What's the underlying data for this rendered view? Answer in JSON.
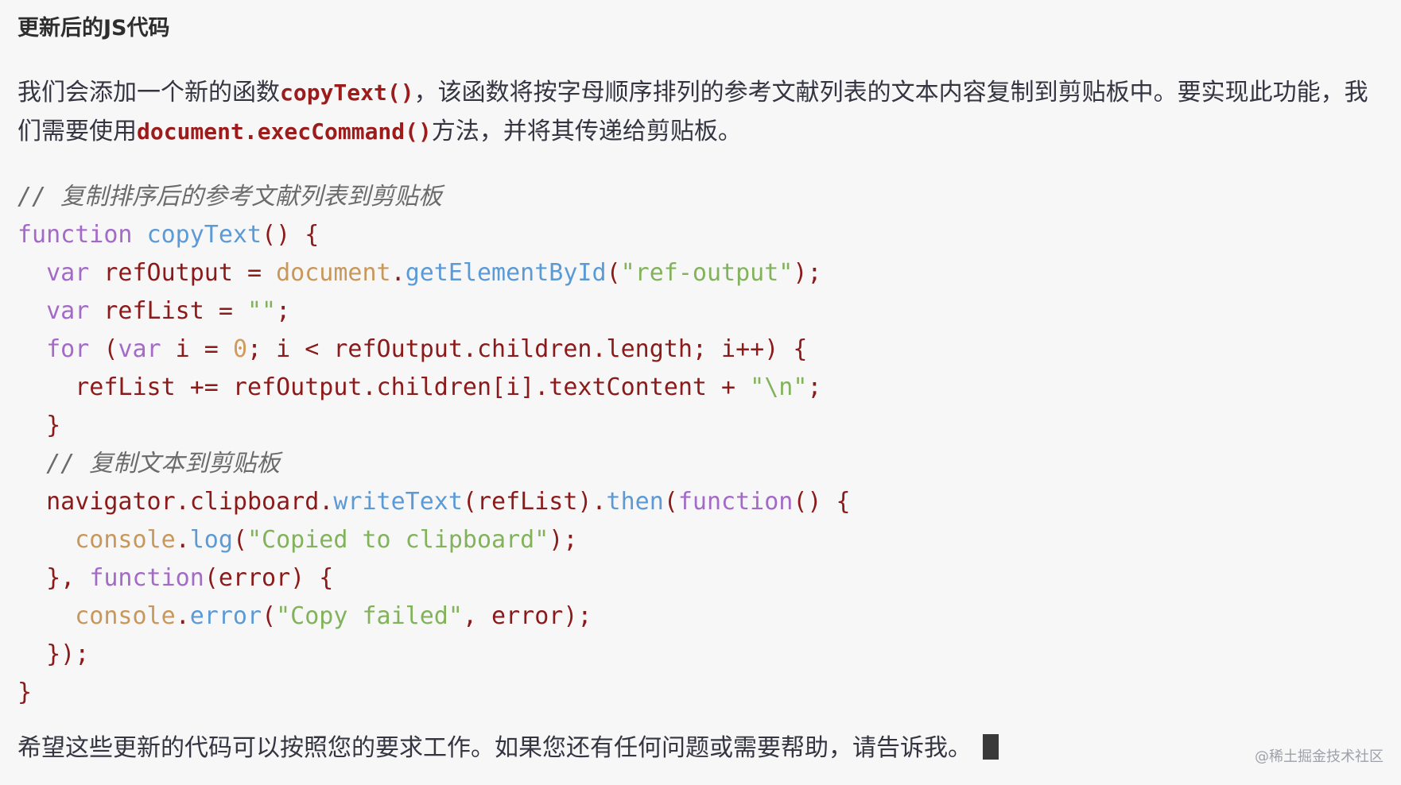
{
  "heading": "更新后的JS代码",
  "intro": {
    "part1": "我们会添加一个新的函数",
    "code1": "copyText()",
    "part2": "，该函数将按字母顺序排列的参考文献列表的文本内容复制到剪贴板中。要实现此功能，我们需要使用",
    "code2": "document.execCommand()",
    "part3": "方法，并将其传递给剪贴板。"
  },
  "code_lines": [
    [
      {
        "t": "cm",
        "v": "// 复制排序后的参考文献列表到剪贴板"
      }
    ],
    [
      {
        "t": "kw",
        "v": "function"
      },
      {
        "t": "tx",
        "v": " "
      },
      {
        "t": "fn",
        "v": "copyText"
      },
      {
        "t": "tx",
        "v": "() {"
      }
    ],
    [
      {
        "t": "tx",
        "v": "  "
      },
      {
        "t": "kw",
        "v": "var"
      },
      {
        "t": "tx",
        "v": " refOutput = "
      },
      {
        "t": "bi",
        "v": "document"
      },
      {
        "t": "tx",
        "v": "."
      },
      {
        "t": "fn",
        "v": "getElementById"
      },
      {
        "t": "tx",
        "v": "("
      },
      {
        "t": "st",
        "v": "\"ref-output\""
      },
      {
        "t": "tx",
        "v": ");"
      }
    ],
    [
      {
        "t": "tx",
        "v": "  "
      },
      {
        "t": "kw",
        "v": "var"
      },
      {
        "t": "tx",
        "v": " refList = "
      },
      {
        "t": "st",
        "v": "\"\""
      },
      {
        "t": "tx",
        "v": ";"
      }
    ],
    [
      {
        "t": "tx",
        "v": "  "
      },
      {
        "t": "kw",
        "v": "for"
      },
      {
        "t": "tx",
        "v": " ("
      },
      {
        "t": "kw",
        "v": "var"
      },
      {
        "t": "tx",
        "v": " i = "
      },
      {
        "t": "nm",
        "v": "0"
      },
      {
        "t": "tx",
        "v": "; i < refOutput.children.length; i++) {"
      }
    ],
    [
      {
        "t": "tx",
        "v": "    refList += refOutput.children[i].textContent + "
      },
      {
        "t": "st",
        "v": "\"\\n\""
      },
      {
        "t": "tx",
        "v": ";"
      }
    ],
    [
      {
        "t": "tx",
        "v": "  }"
      }
    ],
    [
      {
        "t": "tx",
        "v": "  "
      },
      {
        "t": "cm",
        "v": "// 复制文本到剪贴板"
      }
    ],
    [
      {
        "t": "tx",
        "v": "  navigator.clipboard."
      },
      {
        "t": "fn",
        "v": "writeText"
      },
      {
        "t": "tx",
        "v": "(refList)."
      },
      {
        "t": "fn",
        "v": "then"
      },
      {
        "t": "tx",
        "v": "("
      },
      {
        "t": "kw",
        "v": "function"
      },
      {
        "t": "tx",
        "v": "() {"
      }
    ],
    [
      {
        "t": "tx",
        "v": "    "
      },
      {
        "t": "bi",
        "v": "console"
      },
      {
        "t": "tx",
        "v": "."
      },
      {
        "t": "fn",
        "v": "log"
      },
      {
        "t": "tx",
        "v": "("
      },
      {
        "t": "st",
        "v": "\"Copied to clipboard\""
      },
      {
        "t": "tx",
        "v": ");"
      }
    ],
    [
      {
        "t": "tx",
        "v": "  }, "
      },
      {
        "t": "kw",
        "v": "function"
      },
      {
        "t": "tx",
        "v": "(error) {"
      }
    ],
    [
      {
        "t": "tx",
        "v": "    "
      },
      {
        "t": "bi",
        "v": "console"
      },
      {
        "t": "tx",
        "v": "."
      },
      {
        "t": "fn",
        "v": "error"
      },
      {
        "t": "tx",
        "v": "("
      },
      {
        "t": "st",
        "v": "\"Copy failed\""
      },
      {
        "t": "tx",
        "v": ", error);"
      }
    ],
    [
      {
        "t": "tx",
        "v": "  });"
      }
    ],
    [
      {
        "t": "tx",
        "v": "}"
      }
    ]
  ],
  "closing": "希望这些更新的代码可以按照您的要求工作。如果您还有任何问题或需要帮助，请告诉我。",
  "watermark": "@稀土掘金技术社区"
}
